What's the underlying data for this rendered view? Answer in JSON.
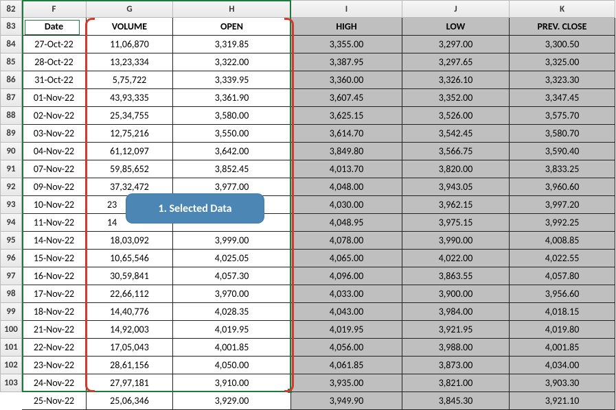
{
  "colhdrs": {
    "F": "F",
    "G": "G",
    "H": "H",
    "I": "I",
    "J": "J",
    "K": "K"
  },
  "rownums": [
    "82",
    "83",
    "84",
    "85",
    "86",
    "87",
    "88",
    "89",
    "90",
    "91",
    "92",
    "93",
    "94",
    "95",
    "96",
    "97",
    "98",
    "99",
    "100",
    "101",
    "102",
    "103"
  ],
  "hdr": {
    "F": "Date",
    "G": "VOLUME",
    "H": "OPEN",
    "I": "HIGH",
    "J": "LOW",
    "K": "PREV. CLOSE"
  },
  "callout": "1. Selected Data",
  "chart_data": {
    "type": "table",
    "columns": [
      "Date",
      "VOLUME",
      "OPEN",
      "HIGH",
      "LOW",
      "PREV. CLOSE"
    ],
    "rows": [
      {
        "date": "27-Oct-22",
        "volume": "11,06,870",
        "open": "3,319.85",
        "high": "3,355.00",
        "low": "3,297.00",
        "prev": "3,300.50"
      },
      {
        "date": "28-Oct-22",
        "volume": "13,23,334",
        "open": "3,322.00",
        "high": "3,387.95",
        "low": "3,297.65",
        "prev": "3,325.00"
      },
      {
        "date": "31-Oct-22",
        "volume": "5,75,722",
        "open": "3,339.95",
        "high": "3,360.00",
        "low": "3,326.10",
        "prev": "3,323.30"
      },
      {
        "date": "01-Nov-22",
        "volume": "43,93,335",
        "open": "3,361.90",
        "high": "3,607.45",
        "low": "3,352.00",
        "prev": "3,347.45"
      },
      {
        "date": "02-Nov-22",
        "volume": "25,34,755",
        "open": "3,580.00",
        "high": "3,625.15",
        "low": "3,526.00",
        "prev": "3,575.70"
      },
      {
        "date": "03-Nov-22",
        "volume": "12,75,216",
        "open": "3,550.00",
        "high": "3,614.70",
        "low": "3,542.45",
        "prev": "3,580.70"
      },
      {
        "date": "04-Nov-22",
        "volume": "61,12,097",
        "open": "3,642.00",
        "high": "3,849.80",
        "low": "3,566.75",
        "prev": "3,590.40"
      },
      {
        "date": "07-Nov-22",
        "volume": "59,85,652",
        "open": "3,852.45",
        "high": "4,013.70",
        "low": "3,820.00",
        "prev": "3,833.25"
      },
      {
        "date": "09-Nov-22",
        "volume": "37,32,472",
        "open": "3,977.00",
        "high": "4,048.00",
        "low": "3,943.05",
        "prev": "3,960.60"
      },
      {
        "date": "10-Nov-22",
        "volume": "23",
        "open": "",
        "high": "4,030.00",
        "low": "3,962.15",
        "prev": "3,997.20"
      },
      {
        "date": "11-Nov-22",
        "volume": "14",
        "open": "",
        "high": "4,048.95",
        "low": "3,975.15",
        "prev": "3,992.25"
      },
      {
        "date": "14-Nov-22",
        "volume": "18,03,092",
        "open": "3,999.00",
        "high": "4,078.00",
        "low": "3,990.00",
        "prev": "4,008.85"
      },
      {
        "date": "15-Nov-22",
        "volume": "10,65,546",
        "open": "4,025.05",
        "high": "4,065.00",
        "low": "4,022.00",
        "prev": "4,022.55"
      },
      {
        "date": "16-Nov-22",
        "volume": "30,59,841",
        "open": "4,057.30",
        "high": "4,096.00",
        "low": "3,863.55",
        "prev": "4,057.80"
      },
      {
        "date": "17-Nov-22",
        "volume": "22,66,112",
        "open": "3,970.00",
        "high": "4,033.00",
        "low": "3,900.00",
        "prev": "3,956.60"
      },
      {
        "date": "18-Nov-22",
        "volume": "14,40,776",
        "open": "4,028.35",
        "high": "4,043.00",
        "low": "3,984.00",
        "prev": "4,018.15"
      },
      {
        "date": "21-Nov-22",
        "volume": "14,92,003",
        "open": "4,019.95",
        "high": "4,019.95",
        "low": "3,921.95",
        "prev": "4,019.80"
      },
      {
        "date": "22-Nov-22",
        "volume": "17,05,043",
        "open": "4,001.85",
        "high": "4,056.00",
        "low": "3,988.00",
        "prev": "4,001.85"
      },
      {
        "date": "23-Nov-22",
        "volume": "28,61,156",
        "open": "4,050.00",
        "high": "4,061.85",
        "low": "3,873.00",
        "prev": "4,034.00"
      },
      {
        "date": "24-Nov-22",
        "volume": "27,97,181",
        "open": "3,910.00",
        "high": "3,935.00",
        "low": "3,821.00",
        "prev": "3,903.30"
      },
      {
        "date": "25-Nov-22",
        "volume": "25,06,346",
        "open": "3,929.00",
        "high": "3,949.90",
        "low": "3,845.30",
        "prev": "3,921.10"
      }
    ]
  }
}
